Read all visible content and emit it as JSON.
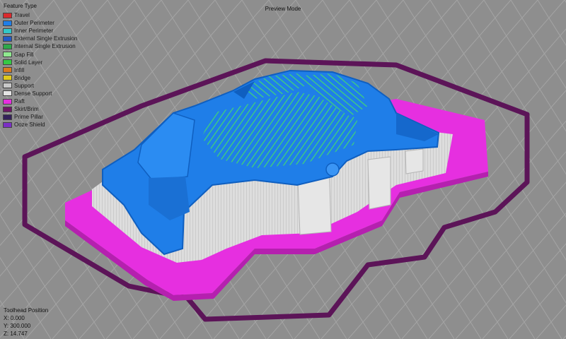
{
  "legend": {
    "title": "Feature Type",
    "items": [
      {
        "label": "Travel",
        "color": "#d9292d"
      },
      {
        "label": "Outer Perimeter",
        "color": "#1f7ee8"
      },
      {
        "label": "Inner Perimeter",
        "color": "#32c8c8"
      },
      {
        "label": "External Single Extrusion",
        "color": "#2459c4"
      },
      {
        "label": "Internal Single Extrusion",
        "color": "#2ea84a"
      },
      {
        "label": "Gap Fill",
        "color": "#8fe88f"
      },
      {
        "label": "Solid Layer",
        "color": "#35c945"
      },
      {
        "label": "Infill",
        "color": "#d97a1e"
      },
      {
        "label": "Bridge",
        "color": "#e0c81c"
      },
      {
        "label": "Support",
        "color": "#c8c8c8"
      },
      {
        "label": "Dense Support",
        "color": "#e4e4e4"
      },
      {
        "label": "Raft",
        "color": "#e62fe0"
      },
      {
        "label": "Skirt/Brim",
        "color": "#6e1766"
      },
      {
        "label": "Prime Pillar",
        "color": "#34215a"
      },
      {
        "label": "Ooze Shield",
        "color": "#7b2fc4"
      }
    ]
  },
  "mode_label": "Preview Mode",
  "toolhead": {
    "title": "Toolhead Position",
    "x": "X: 0.000",
    "y": "Y: 300.000",
    "z": "Z: 14.747"
  },
  "colors": {
    "background": "#8e8e8e",
    "grid": "#a4a4a4",
    "skirt": "#5c1458",
    "raft": "#e62fe0",
    "support": "#dcdcdc",
    "outer_perimeter": "#1f7ee8",
    "infill_lines": "#37c96a"
  }
}
